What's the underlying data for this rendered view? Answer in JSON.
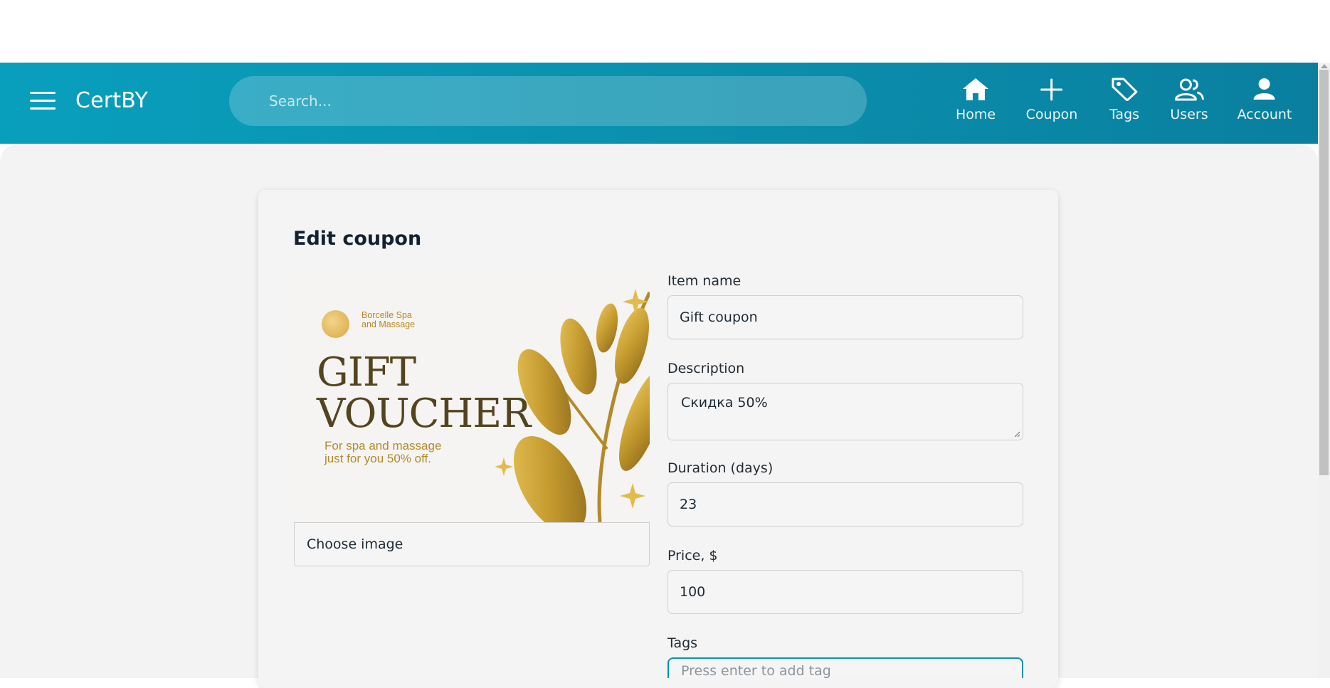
{
  "header": {
    "brand": "CertBY",
    "search_placeholder": "Search...",
    "nav": [
      {
        "label": "Home",
        "icon": "home-icon"
      },
      {
        "label": "Coupon",
        "icon": "plus-icon"
      },
      {
        "label": "Tags",
        "icon": "tag-icon"
      },
      {
        "label": "Users",
        "icon": "users-icon"
      },
      {
        "label": "Account",
        "icon": "account-icon"
      }
    ]
  },
  "form": {
    "title": "Edit coupon",
    "image": {
      "brand_text": "Borcelle Spa\nand Massage",
      "headline": "GIFT\nVOUCHER",
      "subtext": "For spa and massage\njust for you 50% off.",
      "choose_label": "Choose image"
    },
    "fields": {
      "item_name": {
        "label": "Item name",
        "value": "Gift coupon"
      },
      "description": {
        "label": "Description",
        "value": "Скидка 50%"
      },
      "duration": {
        "label": "Duration (days)",
        "value": "23"
      },
      "price": {
        "label": "Price, $",
        "value": "100"
      },
      "tags": {
        "label": "Tags",
        "placeholder": "Press enter to add tag"
      }
    }
  },
  "colors": {
    "header_start": "#089fbd",
    "header_end": "#0a7f9f",
    "accent": "#0a92b0",
    "content_bg": "#f3f3f3",
    "gold": "#c9a034"
  }
}
